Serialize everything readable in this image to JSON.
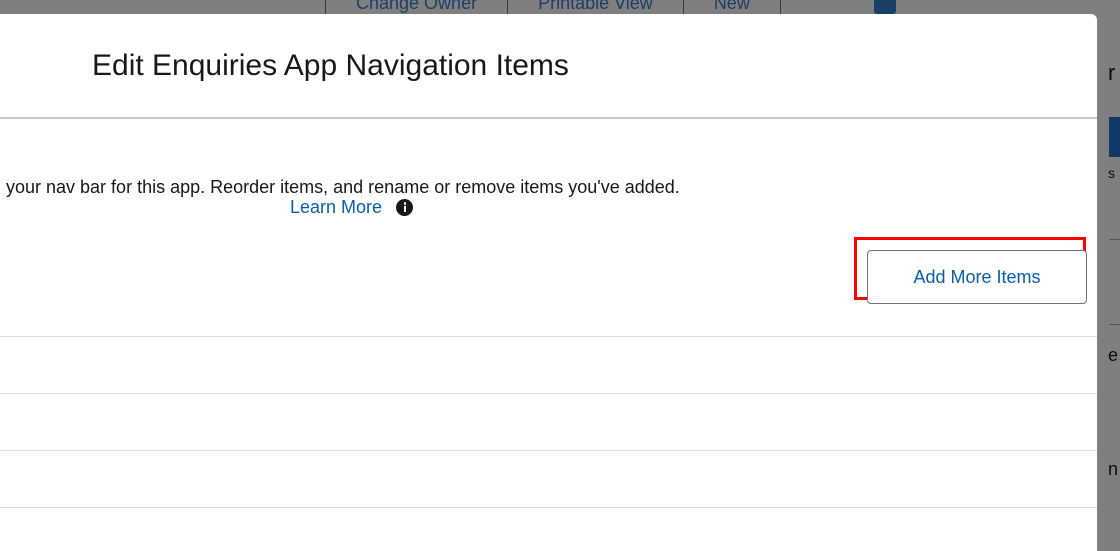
{
  "background": {
    "top_buttons": [
      "Change Owner",
      "Printable View",
      "New"
    ],
    "right_fragments": [
      "r",
      "s",
      "e",
      "n"
    ]
  },
  "modal": {
    "title": "Edit Enquiries App Navigation Items",
    "description": "your nav bar for this app. Reorder items, and rename or remove items you've added.",
    "learn_more_label": "Learn More",
    "info_icon": "info-icon",
    "add_more_items_label": "Add More Items",
    "highlight_color": "#ff0000",
    "link_color": "#0b5cab",
    "nav_items": [
      "",
      "",
      "",
      ""
    ]
  }
}
